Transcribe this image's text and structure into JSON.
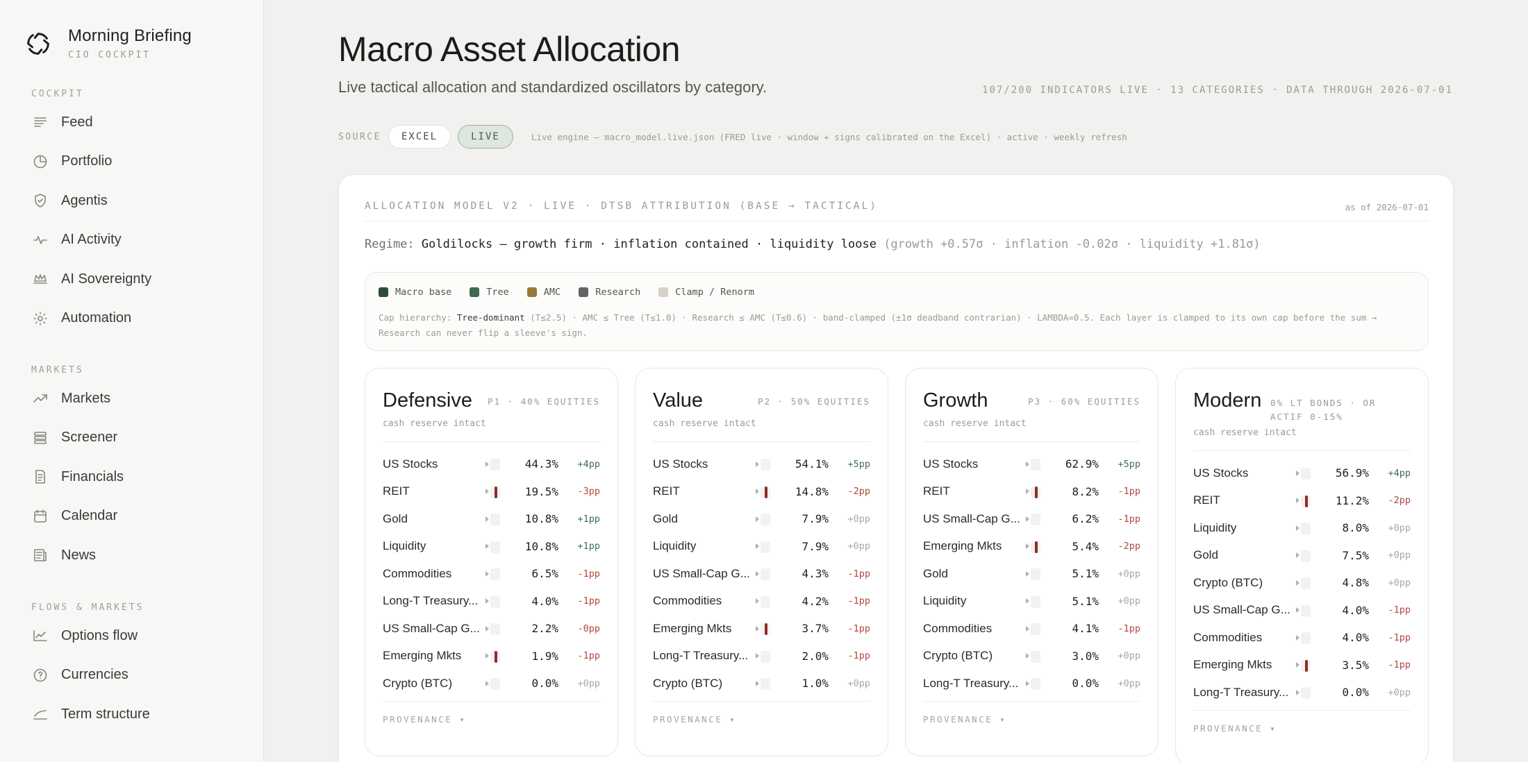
{
  "brand": {
    "title": "Morning Briefing",
    "subtitle": "CIO COCKPIT"
  },
  "sidebar": {
    "sections": [
      {
        "heading": "COCKPIT",
        "items": [
          {
            "label": "Feed",
            "icon": "feed-icon"
          },
          {
            "label": "Portfolio",
            "icon": "pie-icon"
          },
          {
            "label": "Agentis",
            "icon": "shield-icon"
          },
          {
            "label": "AI Activity",
            "icon": "activity-icon"
          },
          {
            "label": "AI Sovereignty",
            "icon": "crown-icon"
          },
          {
            "label": "Automation",
            "icon": "gear-icon"
          }
        ]
      },
      {
        "heading": "MARKETS",
        "items": [
          {
            "label": "Markets",
            "icon": "trend-icon"
          },
          {
            "label": "Screener",
            "icon": "layers-icon"
          },
          {
            "label": "Financials",
            "icon": "document-icon"
          },
          {
            "label": "Calendar",
            "icon": "calendar-icon"
          },
          {
            "label": "News",
            "icon": "newspaper-icon"
          }
        ]
      },
      {
        "heading": "FLOWS & MARKETS",
        "items": [
          {
            "label": "Options flow",
            "icon": "flow-icon"
          },
          {
            "label": "Currencies",
            "icon": "currency-icon"
          },
          {
            "label": "Term structure",
            "icon": "curve-icon"
          }
        ]
      }
    ]
  },
  "header": {
    "title": "Macro Asset Allocation",
    "subtitle": "Live tactical allocation and standardized oscillators by category.",
    "meta": "107/200 INDICATORS LIVE · 13 CATEGORIES · DATA THROUGH 2026-07-01"
  },
  "source": {
    "label": "SOURCE",
    "options": [
      "EXCEL",
      "LIVE"
    ],
    "selected": "LIVE",
    "note": "Live engine — macro_model.live.json (FRED live · window + signs calibrated on the Excel) · active · weekly refresh"
  },
  "model": {
    "title": "ALLOCATION MODEL V2 · LIVE · DTSB ATTRIBUTION (BASE → TACTICAL)",
    "as_of": "as of 2026-07-01",
    "regime_label": "Regime:",
    "regime_value": "Goldilocks — growth firm · inflation contained · liquidity loose",
    "regime_detail": "(growth +0.57σ · inflation -0.02σ · liquidity +1.81σ)",
    "legend": [
      {
        "label": "Macro base",
        "color": "#2f4a3a"
      },
      {
        "label": "Tree",
        "color": "#3d6b50"
      },
      {
        "label": "AMC",
        "color": "#9a7a3a"
      },
      {
        "label": "Research",
        "color": "#5f6460"
      },
      {
        "label": "Clamp / Renorm",
        "color": "#d8d2c6"
      }
    ],
    "cap_prefix": "Cap hierarchy:",
    "cap_bold": "Tree-dominant",
    "cap_rest": "(T≤2.5) · AMC ≤ Tree (T≤1.0) · Research ≤ AMC (T≤0.6) · band-clamped (±1σ deadband contrarian) · LAMBDA=0.5. Each layer is clamped to its own cap before the sum → Research can never flip a sleeve's sign."
  },
  "portfolios": [
    {
      "name": "Defensive",
      "tag": "P1 · 40% EQUITIES",
      "note": "cash reserve intact",
      "provenance": "PROVENANCE ▾",
      "rows": [
        {
          "name": "US Stocks",
          "pct": "44.3%",
          "delta": "+4pp",
          "tilt": 0
        },
        {
          "name": "REIT",
          "pct": "19.5%",
          "delta": "-3pp",
          "tilt": 1
        },
        {
          "name": "Gold",
          "pct": "10.8%",
          "delta": "+1pp",
          "tilt": 0
        },
        {
          "name": "Liquidity",
          "pct": "10.8%",
          "delta": "+1pp",
          "tilt": 0
        },
        {
          "name": "Commodities",
          "pct": "6.5%",
          "delta": "-1pp",
          "tilt": 0
        },
        {
          "name": "Long-T Treasury...",
          "pct": "4.0%",
          "delta": "-1pp",
          "tilt": 0
        },
        {
          "name": "US Small-Cap G...",
          "pct": "2.2%",
          "delta": "-0pp",
          "tilt": 0
        },
        {
          "name": "Emerging Mkts",
          "pct": "1.9%",
          "delta": "-1pp",
          "tilt": 1
        },
        {
          "name": "Crypto (BTC)",
          "pct": "0.0%",
          "delta": "+0pp",
          "tilt": 0
        }
      ]
    },
    {
      "name": "Value",
      "tag": "P2 · 50% EQUITIES",
      "note": "cash reserve intact",
      "provenance": "PROVENANCE ▾",
      "rows": [
        {
          "name": "US Stocks",
          "pct": "54.1%",
          "delta": "+5pp",
          "tilt": 0
        },
        {
          "name": "REIT",
          "pct": "14.8%",
          "delta": "-2pp",
          "tilt": 1
        },
        {
          "name": "Gold",
          "pct": "7.9%",
          "delta": "+0pp",
          "tilt": 0
        },
        {
          "name": "Liquidity",
          "pct": "7.9%",
          "delta": "+0pp",
          "tilt": 0
        },
        {
          "name": "US Small-Cap G...",
          "pct": "4.3%",
          "delta": "-1pp",
          "tilt": 0
        },
        {
          "name": "Commodities",
          "pct": "4.2%",
          "delta": "-1pp",
          "tilt": 0
        },
        {
          "name": "Emerging Mkts",
          "pct": "3.7%",
          "delta": "-1pp",
          "tilt": 1
        },
        {
          "name": "Long-T Treasury...",
          "pct": "2.0%",
          "delta": "-1pp",
          "tilt": 0
        },
        {
          "name": "Crypto (BTC)",
          "pct": "1.0%",
          "delta": "+0pp",
          "tilt": 0
        }
      ]
    },
    {
      "name": "Growth",
      "tag": "P3 · 60% EQUITIES",
      "note": "cash reserve intact",
      "provenance": "PROVENANCE ▾",
      "rows": [
        {
          "name": "US Stocks",
          "pct": "62.9%",
          "delta": "+5pp",
          "tilt": 0
        },
        {
          "name": "REIT",
          "pct": "8.2%",
          "delta": "-1pp",
          "tilt": 1
        },
        {
          "name": "US Small-Cap G...",
          "pct": "6.2%",
          "delta": "-1pp",
          "tilt": 0
        },
        {
          "name": "Emerging Mkts",
          "pct": "5.4%",
          "delta": "-2pp",
          "tilt": 1
        },
        {
          "name": "Gold",
          "pct": "5.1%",
          "delta": "+0pp",
          "tilt": 0
        },
        {
          "name": "Liquidity",
          "pct": "5.1%",
          "delta": "+0pp",
          "tilt": 0
        },
        {
          "name": "Commodities",
          "pct": "4.1%",
          "delta": "-1pp",
          "tilt": 0
        },
        {
          "name": "Crypto (BTC)",
          "pct": "3.0%",
          "delta": "+0pp",
          "tilt": 0
        },
        {
          "name": "Long-T Treasury...",
          "pct": "0.0%",
          "delta": "+0pp",
          "tilt": 0
        }
      ]
    },
    {
      "name": "Modern",
      "tag": "0% LT BONDS · OR ACTIF 0-15%",
      "note": "cash reserve intact",
      "provenance": "PROVENANCE ▾",
      "rows": [
        {
          "name": "US Stocks",
          "pct": "56.9%",
          "delta": "+4pp",
          "tilt": 0
        },
        {
          "name": "REIT",
          "pct": "11.2%",
          "delta": "-2pp",
          "tilt": 1
        },
        {
          "name": "Liquidity",
          "pct": "8.0%",
          "delta": "+0pp",
          "tilt": 0
        },
        {
          "name": "Gold",
          "pct": "7.5%",
          "delta": "+0pp",
          "tilt": 0
        },
        {
          "name": "Crypto (BTC)",
          "pct": "4.8%",
          "delta": "+0pp",
          "tilt": 0
        },
        {
          "name": "US Small-Cap G...",
          "pct": "4.0%",
          "delta": "-1pp",
          "tilt": 0
        },
        {
          "name": "Commodities",
          "pct": "4.0%",
          "delta": "-1pp",
          "tilt": 0
        },
        {
          "name": "Emerging Mkts",
          "pct": "3.5%",
          "delta": "-1pp",
          "tilt": 1
        },
        {
          "name": "Long-T Treasury...",
          "pct": "0.0%",
          "delta": "+0pp",
          "tilt": 0
        }
      ]
    }
  ]
}
